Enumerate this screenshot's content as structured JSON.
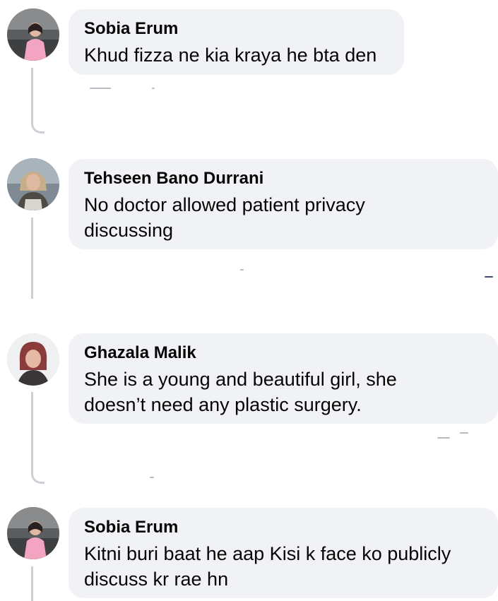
{
  "comments": [
    {
      "author": "Sobia Erum",
      "text": "Khud fizza ne kia kraya he bta den",
      "avatar_icon": "child-photo-avatar"
    },
    {
      "author": "Tehseen Bano Durrani",
      "text": "No doctor allowed patient privacy discussing",
      "avatar_icon": "woman-photo-avatar"
    },
    {
      "author": "Ghazala Malik",
      "text": "She is a young and beautiful girl, she doesn’t need any plastic surgery.",
      "avatar_icon": "woman-photo-avatar"
    },
    {
      "author": "Sobia Erum",
      "text": "Kitni buri baat he aap Kisi k face ko publicly discuss kr rae hn",
      "avatar_icon": "child-photo-avatar"
    }
  ],
  "colors": {
    "bubble_background": "#f0f2f5",
    "thread_line": "#ccd0d5",
    "text": "#050505"
  }
}
